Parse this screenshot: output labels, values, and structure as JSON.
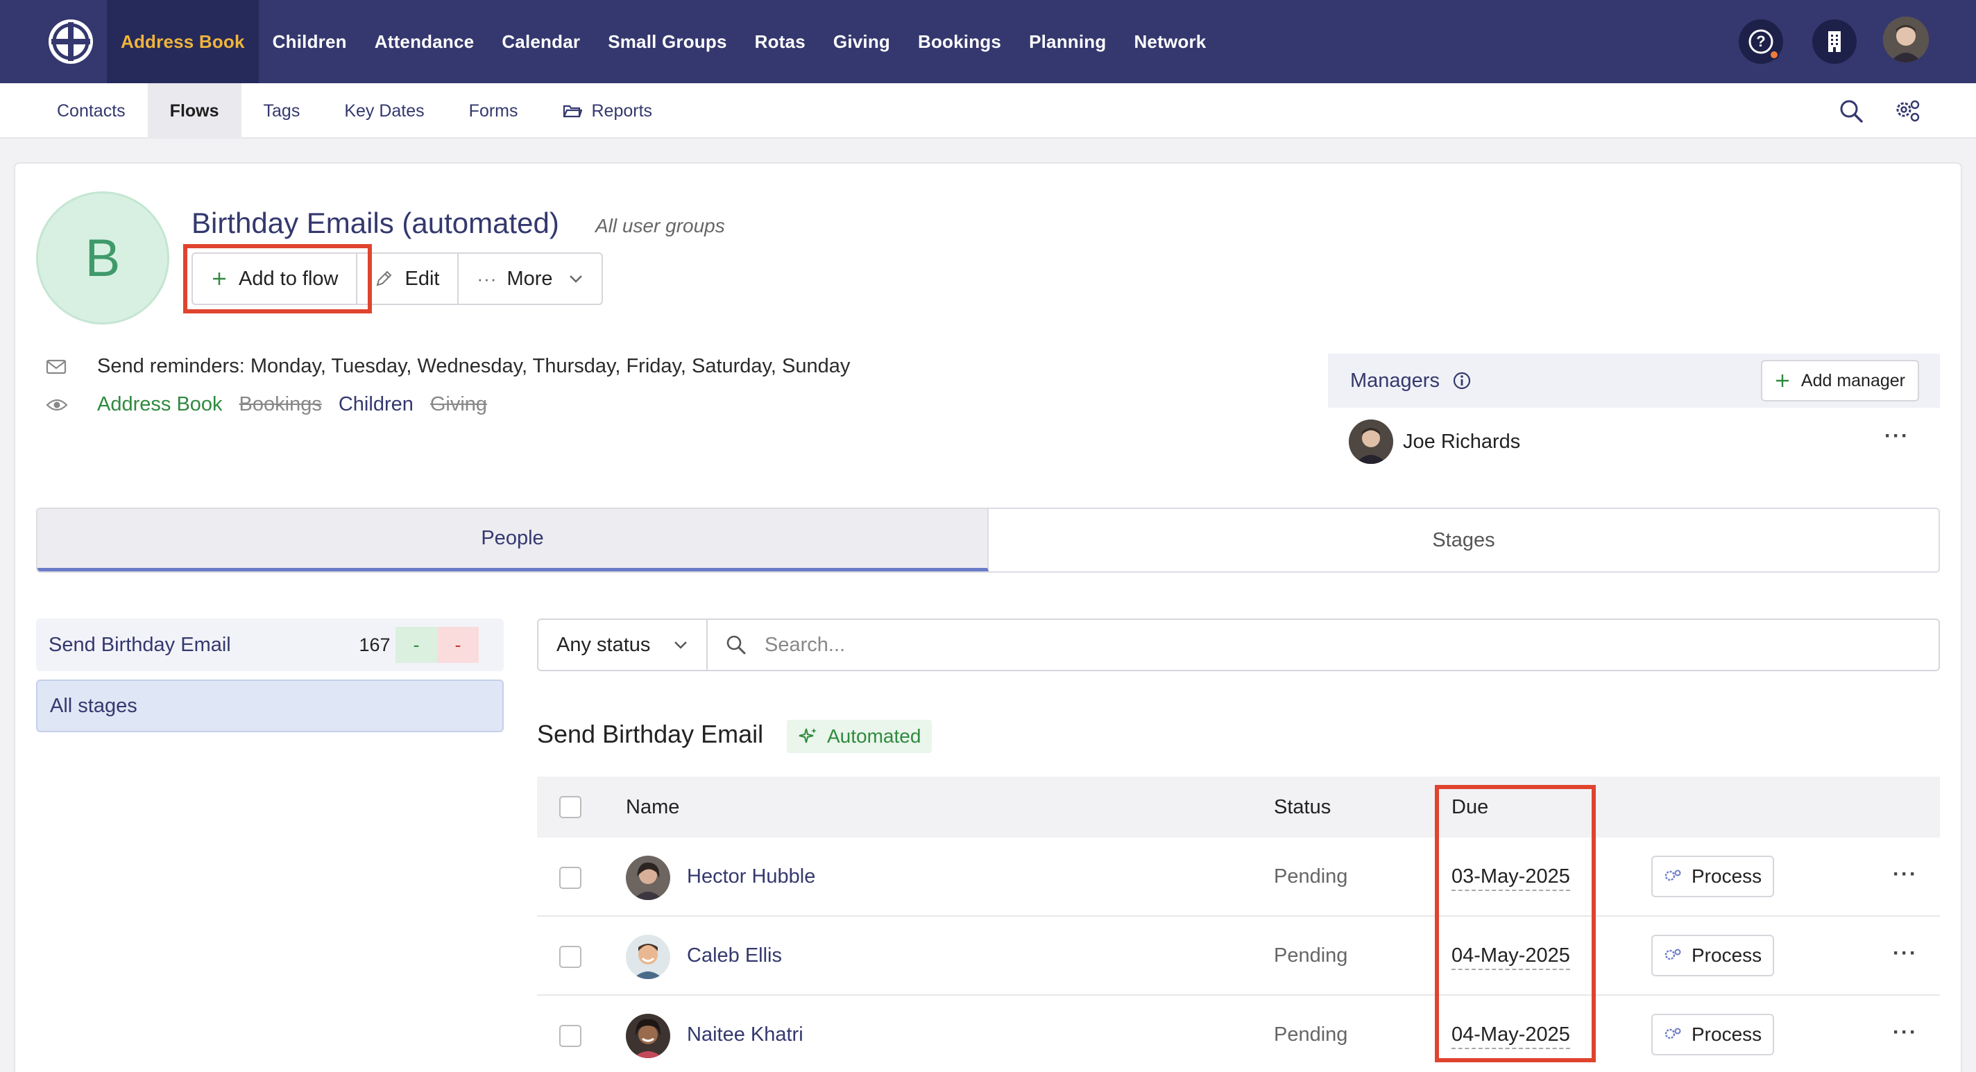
{
  "topnav": {
    "items": [
      {
        "label": "Address Book",
        "active": true
      },
      {
        "label": "Children"
      },
      {
        "label": "Attendance"
      },
      {
        "label": "Calendar"
      },
      {
        "label": "Small Groups"
      },
      {
        "label": "Rotas"
      },
      {
        "label": "Giving"
      },
      {
        "label": "Bookings"
      },
      {
        "label": "Planning"
      },
      {
        "label": "Network"
      }
    ],
    "icons": [
      "help-icon",
      "building-icon",
      "user-avatar"
    ]
  },
  "subnav": {
    "items": [
      {
        "label": "Contacts"
      },
      {
        "label": "Flows",
        "active": true
      },
      {
        "label": "Tags"
      },
      {
        "label": "Key Dates"
      },
      {
        "label": "Forms"
      },
      {
        "label": "Reports",
        "icon": "folder-icon"
      }
    ],
    "right_icons": [
      "search-icon",
      "settings-icon"
    ]
  },
  "flow": {
    "avatar_letter": "B",
    "title": "Birthday Emails (automated)",
    "subtitle": "All user groups",
    "actions": {
      "add_label": "Add to flow",
      "edit_label": "Edit",
      "more_label": "More"
    },
    "reminders": "Send reminders: Monday, Tuesday, Wednesday, Thursday, Friday, Saturday, Sunday",
    "visibility": [
      {
        "label": "Address Book",
        "state": "on"
      },
      {
        "label": "Bookings",
        "state": "off"
      },
      {
        "label": "Children",
        "state": "on"
      },
      {
        "label": "Giving",
        "state": "off"
      }
    ]
  },
  "managers": {
    "title": "Managers",
    "add_label": "Add manager",
    "people": [
      {
        "name": "Joe Richards"
      }
    ]
  },
  "tabs": [
    {
      "label": "People",
      "active": true
    },
    {
      "label": "Stages"
    }
  ],
  "stages": {
    "items": [
      {
        "label": "Send Birthday Email",
        "count": "167",
        "green": "-",
        "red": "-"
      },
      {
        "label": "All stages",
        "selected": true
      }
    ]
  },
  "filters": {
    "status_value": "Any status",
    "search_placeholder": "Search..."
  },
  "section": {
    "title": "Send Birthday Email",
    "badge": "Automated"
  },
  "table": {
    "headers": {
      "name": "Name",
      "status": "Status",
      "due": "Due"
    },
    "process_label": "Process",
    "rows": [
      {
        "name": "Hector Hubble",
        "status": "Pending",
        "due": "03-May-2025"
      },
      {
        "name": "Caleb Ellis",
        "status": "Pending",
        "due": "04-May-2025"
      },
      {
        "name": "Naitee Khatri",
        "status": "Pending",
        "due": "04-May-2025"
      }
    ]
  },
  "colors": {
    "nav_bg": "#34386e",
    "nav_active_text": "#f0b43c",
    "link": "#34386e",
    "green": "#2f8a3e",
    "highlight": "#e0442e"
  }
}
